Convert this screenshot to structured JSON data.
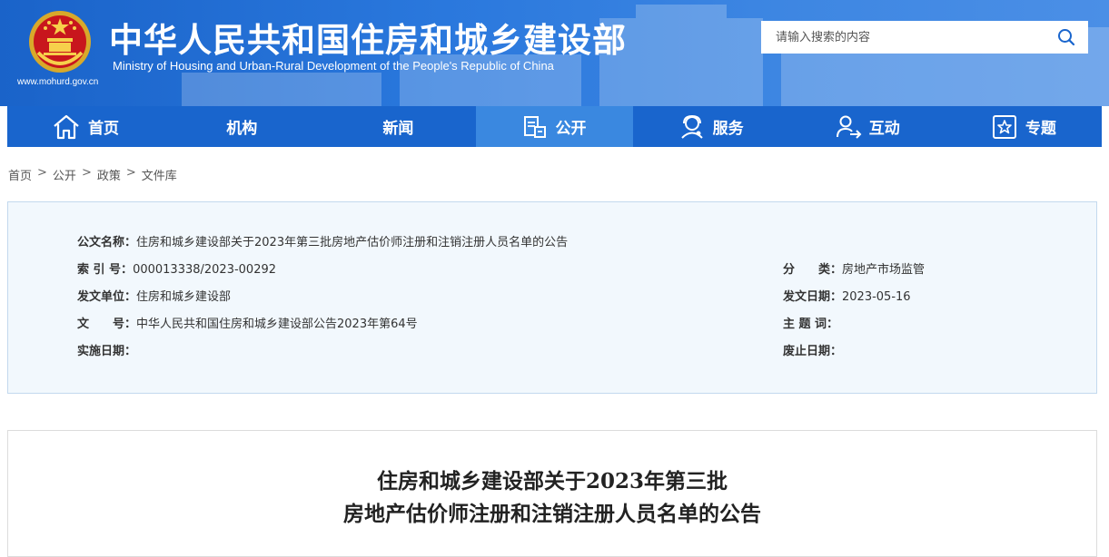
{
  "header": {
    "title_cn": "中华人民共和国住房和城乡建设部",
    "title_en": "Ministry of Housing and Urban-Rural Development of the People's Republic of China",
    "site_url": "www.mohurd.gov.cn"
  },
  "search": {
    "placeholder": "请输入搜索的内容",
    "icon": "search-icon"
  },
  "nav": {
    "items": [
      {
        "label": "首页",
        "icon": "home-icon"
      },
      {
        "label": "机构",
        "icon": ""
      },
      {
        "label": "新闻",
        "icon": ""
      },
      {
        "label": "公开",
        "icon": "document-icon",
        "active": true
      },
      {
        "label": "服务",
        "icon": "service-icon"
      },
      {
        "label": "互动",
        "icon": "interaction-icon"
      },
      {
        "label": "专题",
        "icon": "star-icon"
      }
    ]
  },
  "breadcrumb": {
    "items": [
      "首页",
      "公开",
      "政策",
      "文件库"
    ],
    "separator": ">"
  },
  "meta": {
    "title_key": "公文名称：",
    "title_val": "住房和城乡建设部关于2023年第三批房地产估价师注册和注销注册人员名单的公告",
    "index_key": "索 引 号：",
    "index_val": "000013338/2023-00292",
    "category_key": "分　　类：",
    "category_val": "房地产市场监管",
    "issuer_key": "发文单位：",
    "issuer_val": "住房和城乡建设部",
    "date_key": "发文日期：",
    "date_val": "2023-05-16",
    "doc_no_key": "文　　号：",
    "doc_no_val": "中华人民共和国住房和城乡建设部公告2023年第64号",
    "subject_key": "主 题 词：",
    "subject_val": "",
    "impl_key": "实施日期：",
    "impl_val": "",
    "abolish_key": "废止日期：",
    "abolish_val": ""
  },
  "article": {
    "title_line1": "住房和城乡建设部关于2023年第三批",
    "title_line2": "房地产估价师注册和注销注册人员名单的公告"
  },
  "colors": {
    "header_blue": "#1a63c9",
    "nav_blue": "#1965cd",
    "nav_active": "#3a88e0",
    "meta_bg": "#f2f8fd"
  }
}
